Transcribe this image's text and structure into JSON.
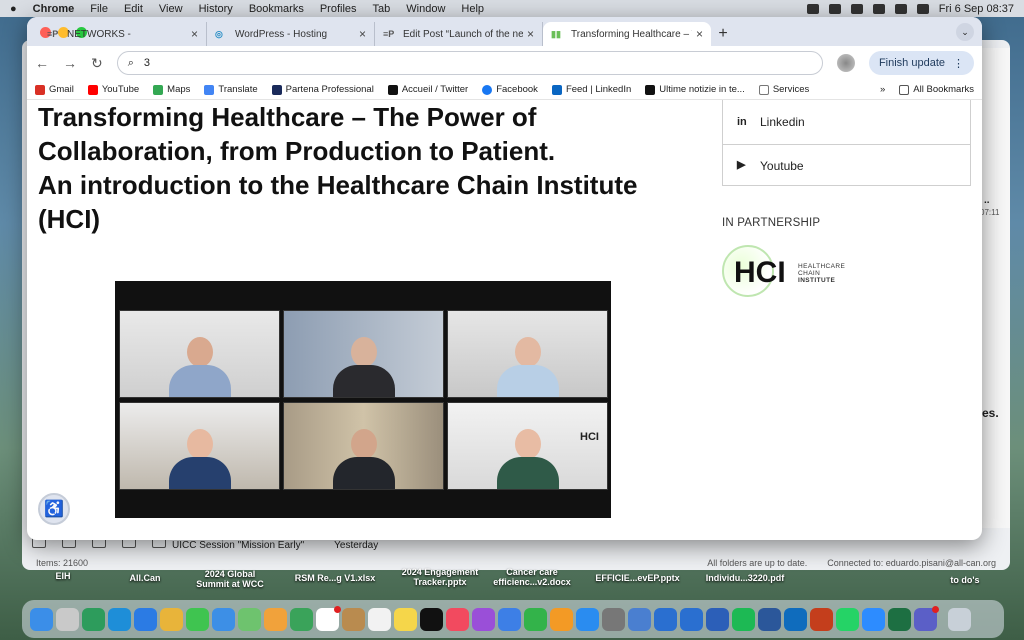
{
  "menubar": {
    "apple": "",
    "app": "Chrome",
    "items": [
      "File",
      "Edit",
      "View",
      "History",
      "Bookmarks",
      "Profiles",
      "Tab",
      "Window",
      "Help"
    ],
    "clock": "Fri 6 Sep 08:37"
  },
  "tabs": [
    {
      "icon": "networks-icon",
      "glyph": "≡P",
      "label": "NETWORKS -"
    },
    {
      "icon": "wordpress-icon",
      "glyph": "◎",
      "label": "WordPress - Hosting"
    },
    {
      "icon": "edit-post-icon",
      "glyph": "≡P",
      "label": "Edit Post “Launch of the new"
    },
    {
      "icon": "page-icon",
      "glyph": "▮▮",
      "label": "Transforming Healthcare – Th"
    }
  ],
  "toolbar": {
    "omnibox_value": "3",
    "finish_update": "Finish update"
  },
  "bookmarks": [
    {
      "label": "Gmail",
      "color": "#d93025"
    },
    {
      "label": "YouTube",
      "color": "#ff0000"
    },
    {
      "label": "Maps",
      "color": "#34a853"
    },
    {
      "label": "Translate",
      "color": "#4285f4"
    },
    {
      "label": "Partena Professional",
      "color": "#1a2a5a"
    },
    {
      "label": "Accueil / Twitter",
      "color": "#111111"
    },
    {
      "label": "Facebook",
      "color": "#1877f2"
    },
    {
      "label": "Feed | LinkedIn",
      "color": "#0a66c2"
    },
    {
      "label": "Ultime notizie in te...",
      "color": "#111111"
    },
    {
      "label": "Services",
      "color": "#777777"
    }
  ],
  "bookmarks_more": "»",
  "bookmarks_all": "All Bookmarks",
  "article": {
    "title_lines": [
      "Transforming Healthcare – The Power of",
      "Collaboration, from Production to Patient.",
      "An introduction to the Healthcare Chain Institute",
      "(HCI)"
    ],
    "photo_badge": "HCI"
  },
  "sidebar": {
    "social": [
      {
        "icon": "linkedin-icon",
        "glyph": "in",
        "label": "Linkedin"
      },
      {
        "icon": "youtube-icon",
        "glyph": "▶",
        "label": "Youtube"
      }
    ],
    "partnership_heading": "IN PARTNERSHIP",
    "hci_logo": {
      "mark": "HCI",
      "line1": "HEALTHCARE",
      "line2": "CHAIN",
      "line3": "INSTITUTE"
    }
  },
  "background_window": {
    "items_count": "Items: 21600",
    "row_subject": "UICC Session \"Mission Early\"",
    "row_date": "Yesterday",
    "status_sync": "All folders are up to date.",
    "status_connected": "Connected to: eduardo.pisani@all-can.org",
    "side_time": "07:11",
    "side_dots": "..",
    "side_text": "es."
  },
  "desktop_files": [
    {
      "label": "EIH"
    },
    {
      "label": "All.Can"
    },
    {
      "label": "2024 Global\nSummit at WCC"
    },
    {
      "label": "RSM Re...g V1.xlsx"
    },
    {
      "label": "2024 Engagement\nTracker.pptx"
    },
    {
      "label": "Cancer care\nefficienc...v2.docx"
    },
    {
      "label": "EFFICIE...evEP.pptx"
    },
    {
      "label": "Individu...3220.pdf"
    },
    {
      "label": "to do's"
    }
  ],
  "colors": {
    "tabbar": "#dfe4ef",
    "finish_button": "#dbe5f5",
    "hci_green": "#bfe6b0"
  }
}
